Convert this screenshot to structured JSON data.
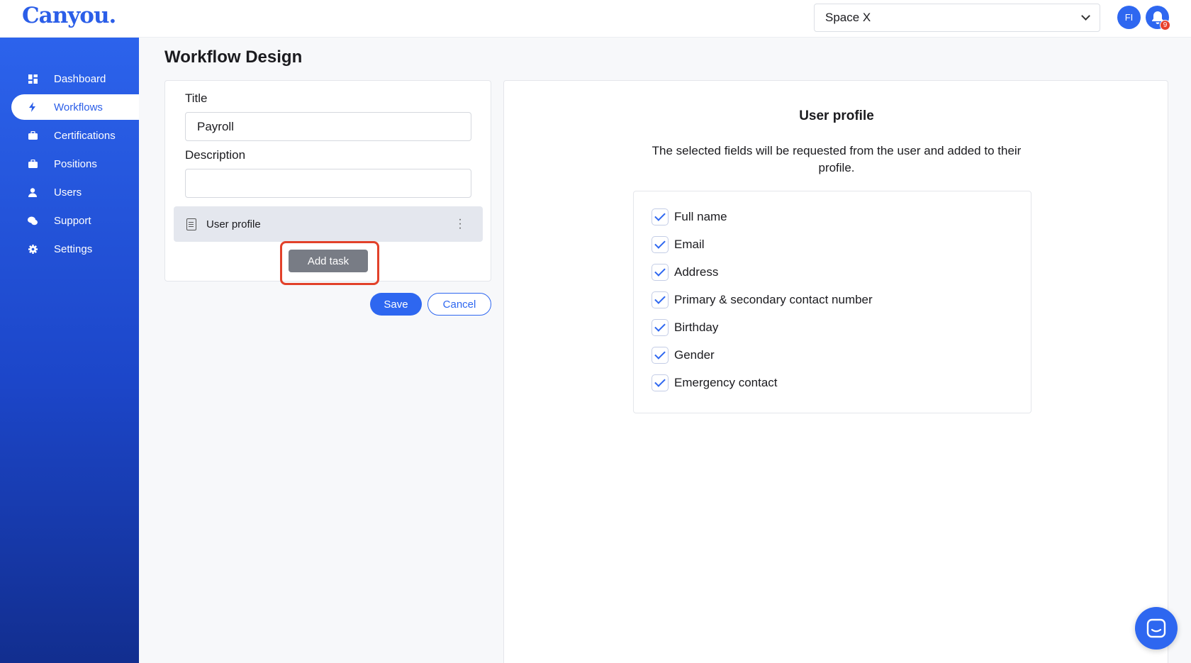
{
  "app": {
    "logo": "Canyou."
  },
  "header": {
    "space_selector_value": "Space X",
    "avatar_initials": "FI",
    "notification_count": "9"
  },
  "sidebar": {
    "items": [
      {
        "label": "Dashboard",
        "icon": "dashboard-icon",
        "active": false
      },
      {
        "label": "Workflows",
        "icon": "lightning-icon",
        "active": true
      },
      {
        "label": "Certifications",
        "icon": "briefcase-icon",
        "active": false
      },
      {
        "label": "Positions",
        "icon": "briefcase-icon",
        "active": false
      },
      {
        "label": "Users",
        "icon": "user-icon",
        "active": false
      },
      {
        "label": "Support",
        "icon": "chat-icon",
        "active": false
      },
      {
        "label": "Settings",
        "icon": "gear-icon",
        "active": false
      }
    ]
  },
  "main": {
    "page_title": "Workflow Design",
    "form": {
      "title_label": "Title",
      "title_value": "Payroll",
      "description_label": "Description",
      "description_value": "",
      "tasks": [
        {
          "name": "User profile",
          "icon": "document-icon"
        }
      ],
      "add_task_label": "Add task",
      "save_label": "Save",
      "cancel_label": "Cancel"
    },
    "detail": {
      "title": "User profile",
      "description": "The selected fields will be requested from the user and added to their profile.",
      "fields": [
        {
          "label": "Full name",
          "checked": true
        },
        {
          "label": "Email",
          "checked": true
        },
        {
          "label": "Address",
          "checked": true
        },
        {
          "label": "Primary & secondary contact number",
          "checked": true
        },
        {
          "label": "Birthday",
          "checked": true
        },
        {
          "label": "Gender",
          "checked": true
        },
        {
          "label": "Emergency contact",
          "checked": true
        }
      ]
    }
  },
  "colors": {
    "brand": "#2b5ee8",
    "highlight": "#e2412a",
    "button_gray": "#787c85"
  }
}
